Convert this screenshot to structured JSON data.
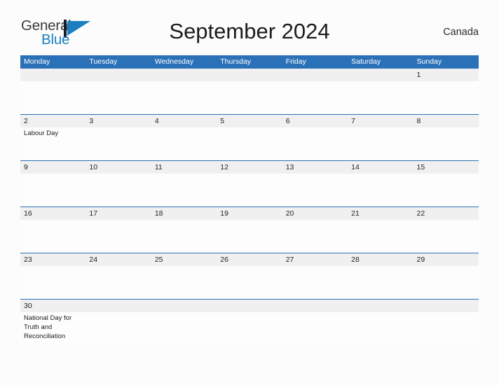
{
  "brand": {
    "word_1": "General",
    "word_2": "Blue",
    "flag_icon": "blue-flag-icon",
    "color_dark": "#3b3b3b",
    "color_blue": "#1a7fc1"
  },
  "header": {
    "title": "September 2024",
    "region": "Canada"
  },
  "calendar": {
    "accent_color": "#2b71b8",
    "band_color": "#f0f0f0",
    "day_names": [
      "Monday",
      "Tuesday",
      "Wednesday",
      "Thursday",
      "Friday",
      "Saturday",
      "Sunday"
    ],
    "weeks": [
      [
        {
          "day": "",
          "events": []
        },
        {
          "day": "",
          "events": []
        },
        {
          "day": "",
          "events": []
        },
        {
          "day": "",
          "events": []
        },
        {
          "day": "",
          "events": []
        },
        {
          "day": "",
          "events": []
        },
        {
          "day": "1",
          "events": []
        }
      ],
      [
        {
          "day": "2",
          "events": [
            "Labour Day"
          ]
        },
        {
          "day": "3",
          "events": []
        },
        {
          "day": "4",
          "events": []
        },
        {
          "day": "5",
          "events": []
        },
        {
          "day": "6",
          "events": []
        },
        {
          "day": "7",
          "events": []
        },
        {
          "day": "8",
          "events": []
        }
      ],
      [
        {
          "day": "9",
          "events": []
        },
        {
          "day": "10",
          "events": []
        },
        {
          "day": "11",
          "events": []
        },
        {
          "day": "12",
          "events": []
        },
        {
          "day": "13",
          "events": []
        },
        {
          "day": "14",
          "events": []
        },
        {
          "day": "15",
          "events": []
        }
      ],
      [
        {
          "day": "16",
          "events": []
        },
        {
          "day": "17",
          "events": []
        },
        {
          "day": "18",
          "events": []
        },
        {
          "day": "19",
          "events": []
        },
        {
          "day": "20",
          "events": []
        },
        {
          "day": "21",
          "events": []
        },
        {
          "day": "22",
          "events": []
        }
      ],
      [
        {
          "day": "23",
          "events": []
        },
        {
          "day": "24",
          "events": []
        },
        {
          "day": "25",
          "events": []
        },
        {
          "day": "26",
          "events": []
        },
        {
          "day": "27",
          "events": []
        },
        {
          "day": "28",
          "events": []
        },
        {
          "day": "29",
          "events": []
        }
      ],
      [
        {
          "day": "30",
          "events": [
            "National Day for Truth and Reconciliation"
          ]
        },
        {
          "day": "",
          "events": []
        },
        {
          "day": "",
          "events": []
        },
        {
          "day": "",
          "events": []
        },
        {
          "day": "",
          "events": []
        },
        {
          "day": "",
          "events": []
        },
        {
          "day": "",
          "events": []
        }
      ]
    ]
  }
}
